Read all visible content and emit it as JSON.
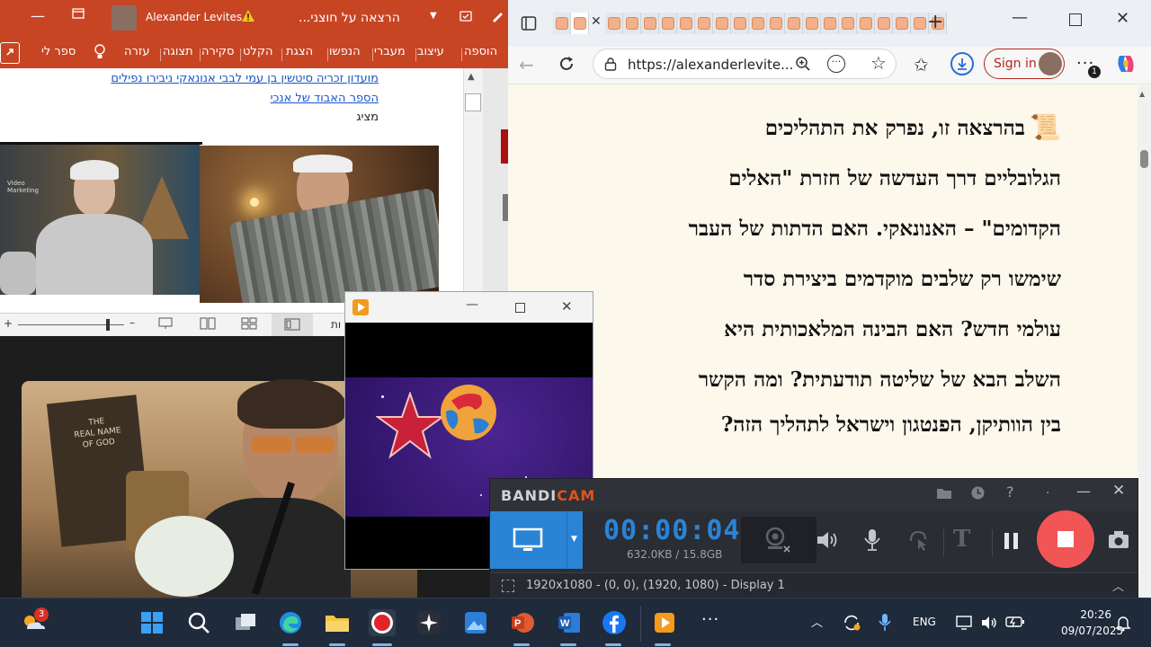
{
  "ppt": {
    "title_app": "Alexander Levites",
    "title_doc": "הרצאה על חוצני...",
    "tabs": [
      "הוספה",
      "עיצוב",
      "מעברי",
      "הנפשו",
      "הצגת",
      "הקלט",
      "סקירה",
      "תצוגה",
      "עזרה",
      "ספר לי"
    ],
    "doc": {
      "link1": "מועדון זכריה סיטשין בן עמי לבבי אנונאקי ניבירו נפילים",
      "link2": "הספר האבוד של אנכי",
      "plain": "מציג"
    },
    "status_frag": "ות"
  },
  "edge": {
    "url": "https://alexanderlevite...",
    "signin": "Sign in",
    "download_badge": "1",
    "paragraph_lines": [
      "בהרצאה זו, נפרק את התהליכים",
      "הגלובליים דרך העדשה של חזרת \"האלים",
      "הקדומים\" – האנונאקי. האם הדתות של העבר",
      "שימשו רק שלבים מוקדמים ביצירת סדר",
      "עולמי חדש? האם הבינה המלאכותית היא",
      "השלב הבא של שליטה תודעתית? ומה הקשר",
      "בין הוותיקן, הפנטגון וישראל לתהליך הזה?"
    ]
  },
  "bandicam": {
    "brand_a": "BANDI",
    "brand_b": "CAM",
    "timer": "00:00:04",
    "size": "632.0KB / 15.8GB",
    "region": "1920x1080 - (0, 0), (1920, 1080) - Display 1",
    "accent": "#2a84d6",
    "rec_color": "#f25555"
  },
  "webcam": {
    "book_lines": [
      "THE",
      "REAL NAME",
      "OF GOD"
    ]
  },
  "taskbar": {
    "notif_badge": "3",
    "lang": "ENG",
    "time": "20:26",
    "date": "09/07/2025"
  }
}
